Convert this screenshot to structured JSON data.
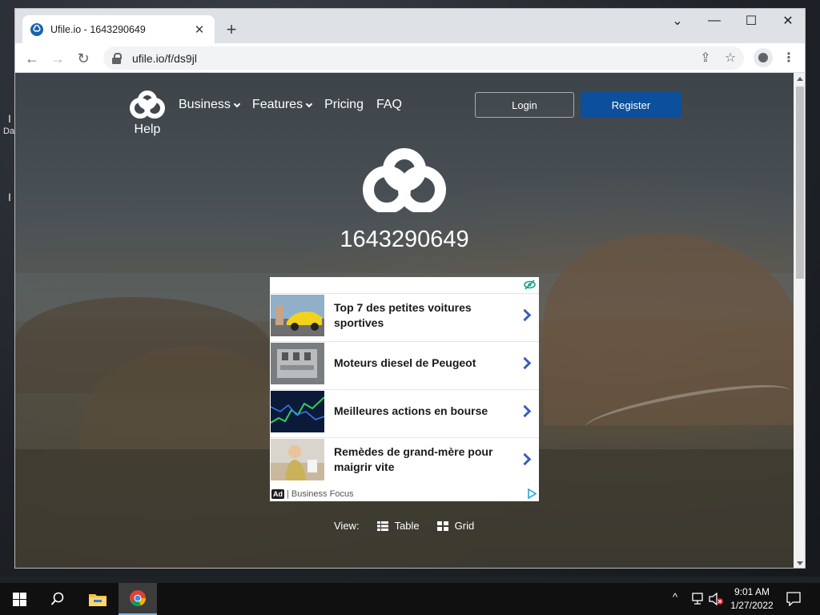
{
  "desktop": {
    "glyphs": [
      "I",
      "Da",
      "I"
    ]
  },
  "browser": {
    "tab_title": "Ufile.io - 1643290649",
    "tab_close": "✕",
    "new_tab": "+",
    "window_controls": {
      "dropdown": "⌄",
      "minimize": "—",
      "maximize": "☐",
      "close": "✕"
    },
    "url": "ufile.io/f/ds9jl",
    "nav_icons": {
      "back": "←",
      "forward": "→",
      "reload": "↻",
      "share": "⇪",
      "bookmark": "☆",
      "menu": "⋮"
    }
  },
  "page": {
    "nav": {
      "help": "Help",
      "items": [
        {
          "label": "Business",
          "dropdown": true
        },
        {
          "label": "Features",
          "dropdown": true
        },
        {
          "label": "Pricing",
          "dropdown": false
        },
        {
          "label": "FAQ",
          "dropdown": false
        }
      ],
      "login": "Login",
      "register": "Register"
    },
    "filename": "1643290649",
    "ad": {
      "items": [
        {
          "text": "Top 7 des petites voitures sportives"
        },
        {
          "text": "Moteurs diesel de Peugeot"
        },
        {
          "text": "Meilleures actions en bourse"
        },
        {
          "text": "Remèdes de grand-mère pour maigrir vite"
        }
      ],
      "badge": "Ad",
      "source": "| Business Focus"
    },
    "view": {
      "label": "View:",
      "table": "Table",
      "grid": "Grid"
    }
  },
  "taskbar": {
    "time": "9:01 AM",
    "date": "1/27/2022",
    "tray_caret": "^"
  },
  "colors": {
    "register": "#0c4f9c",
    "ad_chevron": "#3b5dbd",
    "chrome_tabstrip": "#dee1e6"
  }
}
